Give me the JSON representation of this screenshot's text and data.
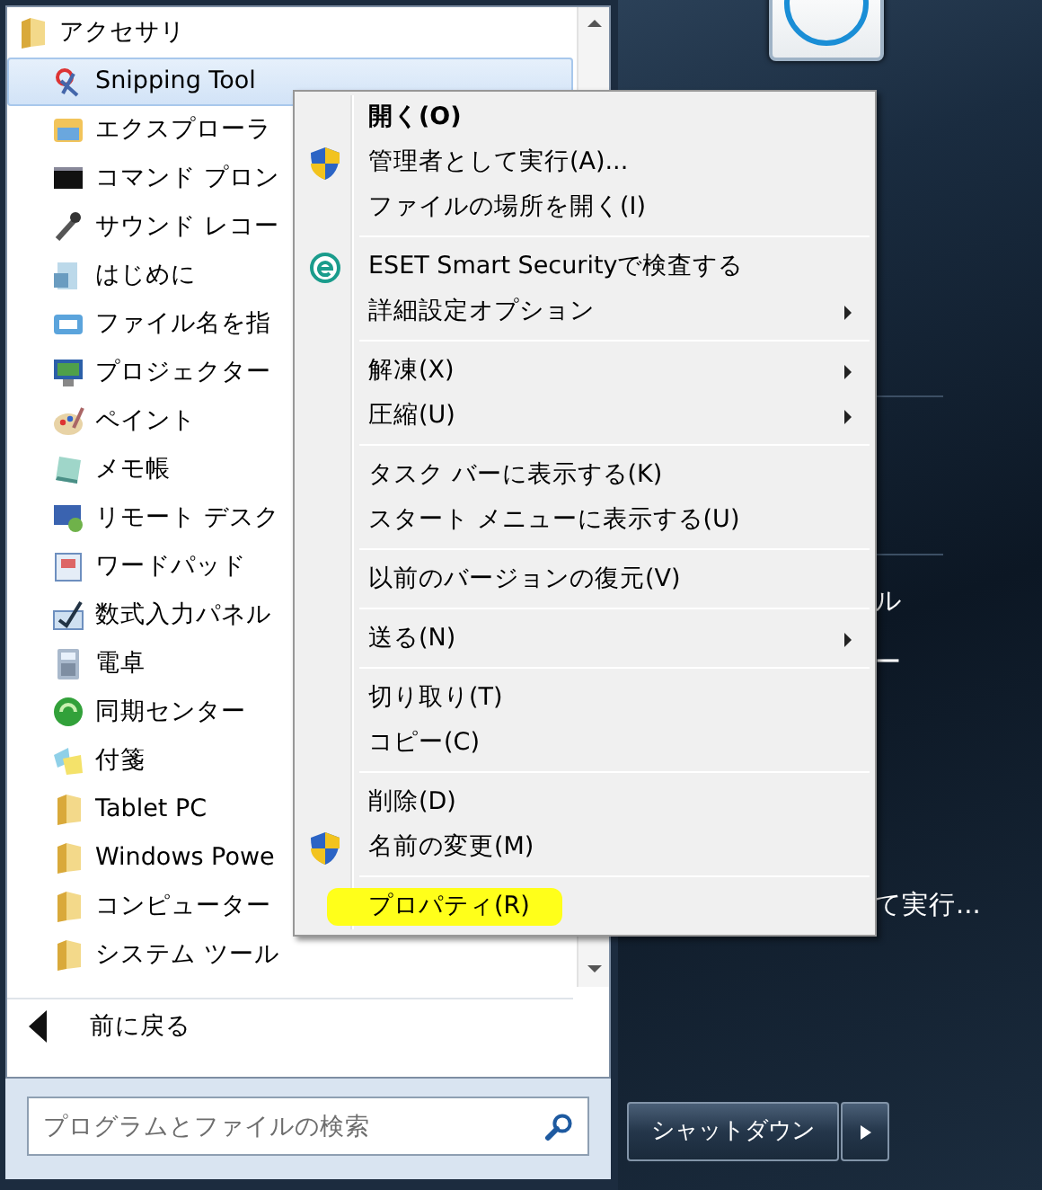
{
  "programs": [
    {
      "label": "アクセサリ",
      "kind": "folder",
      "child": false,
      "selected": false
    },
    {
      "label": "Snipping Tool",
      "kind": "app",
      "child": true,
      "selected": true
    },
    {
      "label": "エクスプローラ",
      "kind": "app",
      "child": true,
      "selected": false
    },
    {
      "label": "コマンド プロン",
      "kind": "app",
      "child": true,
      "selected": false
    },
    {
      "label": "サウンド レコー",
      "kind": "app",
      "child": true,
      "selected": false
    },
    {
      "label": "はじめに",
      "kind": "app",
      "child": true,
      "selected": false
    },
    {
      "label": "ファイル名を指",
      "kind": "app",
      "child": true,
      "selected": false
    },
    {
      "label": "プロジェクター",
      "kind": "app",
      "child": true,
      "selected": false
    },
    {
      "label": "ペイント",
      "kind": "app",
      "child": true,
      "selected": false
    },
    {
      "label": "メモ帳",
      "kind": "app",
      "child": true,
      "selected": false
    },
    {
      "label": "リモート デスク",
      "kind": "app",
      "child": true,
      "selected": false
    },
    {
      "label": "ワードパッド",
      "kind": "app",
      "child": true,
      "selected": false
    },
    {
      "label": "数式入力パネル",
      "kind": "app",
      "child": true,
      "selected": false
    },
    {
      "label": "電卓",
      "kind": "app",
      "child": true,
      "selected": false
    },
    {
      "label": "同期センター",
      "kind": "app",
      "child": true,
      "selected": false
    },
    {
      "label": "付箋",
      "kind": "app",
      "child": true,
      "selected": false
    },
    {
      "label": "Tablet PC",
      "kind": "folder",
      "child": true,
      "selected": false
    },
    {
      "label": "Windows Powe",
      "kind": "folder",
      "child": true,
      "selected": false
    },
    {
      "label": "コンピューター",
      "kind": "folder",
      "child": true,
      "selected": false
    },
    {
      "label": "システム ツール",
      "kind": "folder",
      "child": true,
      "selected": false
    }
  ],
  "back": {
    "label": "前に戻る"
  },
  "search": {
    "placeholder": "プログラムとファイルの検索"
  },
  "right_items": [
    {
      "kind": "separator"
    },
    {
      "kind": "separator"
    },
    {
      "kind": "text",
      "label": "ル"
    },
    {
      "kind": "text",
      "label": "ー"
    },
    {
      "kind": "text",
      "label": "て実行..."
    }
  ],
  "shutdown": {
    "label": "シャットダウン"
  },
  "context_menu": {
    "groups": [
      [
        {
          "label": "開く(O)",
          "kind": "plain",
          "default": true,
          "submenu": false,
          "highlighted": false
        },
        {
          "label": "管理者として実行(A)...",
          "kind": "shield",
          "default": false,
          "submenu": false,
          "highlighted": false
        },
        {
          "label": "ファイルの場所を開く(I)",
          "kind": "plain",
          "default": false,
          "submenu": false,
          "highlighted": false
        }
      ],
      [
        {
          "label": "ESET Smart Securityで検査する",
          "kind": "eset",
          "default": false,
          "submenu": false,
          "highlighted": false
        },
        {
          "label": "詳細設定オプション",
          "kind": "plain",
          "default": false,
          "submenu": true,
          "highlighted": false
        }
      ],
      [
        {
          "label": "解凍(X)",
          "kind": "plain",
          "default": false,
          "submenu": true,
          "highlighted": false
        },
        {
          "label": "圧縮(U)",
          "kind": "plain",
          "default": false,
          "submenu": true,
          "highlighted": false
        }
      ],
      [
        {
          "label": "タスク バーに表示する(K)",
          "kind": "plain",
          "default": false,
          "submenu": false,
          "highlighted": false
        },
        {
          "label": "スタート メニューに表示する(U)",
          "kind": "plain",
          "default": false,
          "submenu": false,
          "highlighted": false
        }
      ],
      [
        {
          "label": "以前のバージョンの復元(V)",
          "kind": "plain",
          "default": false,
          "submenu": false,
          "highlighted": false
        }
      ],
      [
        {
          "label": "送る(N)",
          "kind": "plain",
          "default": false,
          "submenu": true,
          "highlighted": false
        }
      ],
      [
        {
          "label": "切り取り(T)",
          "kind": "plain",
          "default": false,
          "submenu": false,
          "highlighted": false
        },
        {
          "label": "コピー(C)",
          "kind": "plain",
          "default": false,
          "submenu": false,
          "highlighted": false
        }
      ],
      [
        {
          "label": "削除(D)",
          "kind": "plain",
          "default": false,
          "submenu": false,
          "highlighted": false
        },
        {
          "label": "名前の変更(M)",
          "kind": "shield",
          "default": false,
          "submenu": false,
          "highlighted": false
        }
      ],
      [
        {
          "label": "プロパティ(R)",
          "kind": "plain",
          "default": false,
          "submenu": false,
          "highlighted": true
        }
      ]
    ]
  }
}
